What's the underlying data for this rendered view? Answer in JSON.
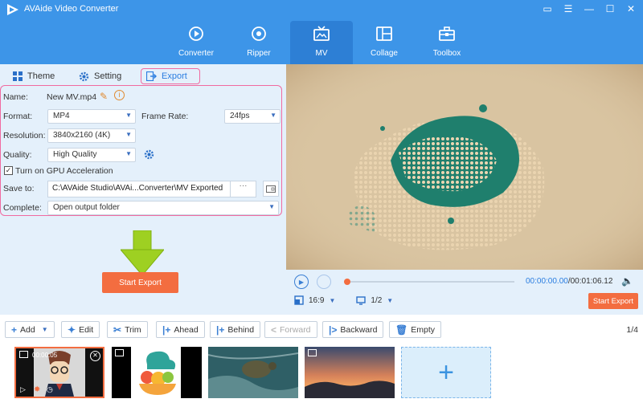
{
  "app": {
    "title": "AVAide Video Converter"
  },
  "nav": [
    {
      "label": "Converter",
      "icon": "converter-icon"
    },
    {
      "label": "Ripper",
      "icon": "ripper-icon"
    },
    {
      "label": "MV",
      "icon": "mv-icon",
      "active": true
    },
    {
      "label": "Collage",
      "icon": "collage-icon"
    },
    {
      "label": "Toolbox",
      "icon": "toolbox-icon"
    }
  ],
  "subtabs": {
    "theme": "Theme",
    "setting": "Setting",
    "export": "Export"
  },
  "export_form": {
    "name_label": "Name:",
    "name_value": "New MV.mp4",
    "format_label": "Format:",
    "format_value": "MP4",
    "frame_rate_label": "Frame Rate:",
    "frame_rate_value": "24fps",
    "resolution_label": "Resolution:",
    "resolution_value": "3840x2160 (4K)",
    "quality_label": "Quality:",
    "quality_value": "High Quality",
    "gpu_label": "Turn on GPU Acceleration",
    "gpu_checked": true,
    "save_to_label": "Save to:",
    "save_to_value": "C:\\AVAide Studio\\AVAi...Converter\\MV Exported",
    "browse_label": "···",
    "complete_label": "Complete:",
    "complete_value": "Open output folder"
  },
  "start_export_label": "Start Export",
  "player": {
    "current_time": "00:00:00.00",
    "total_time": "/00:01:06.12",
    "aspect_ratio": "16:9",
    "page": "1/2",
    "progress": 0
  },
  "toolbar": {
    "add": "Add",
    "edit": "Edit",
    "trim": "Trim",
    "ahead": "Ahead",
    "behind": "Behind",
    "forward": "Forward",
    "backward": "Backward",
    "empty": "Empty",
    "page_count": "1/4"
  },
  "clips": [
    {
      "duration": "00:00:05"
    }
  ],
  "colors": {
    "header_blue": "#3d95e8",
    "accent_orange": "#f36d40",
    "panel_bg": "#e4f0fb",
    "highlight_pink": "#f06aa0"
  }
}
